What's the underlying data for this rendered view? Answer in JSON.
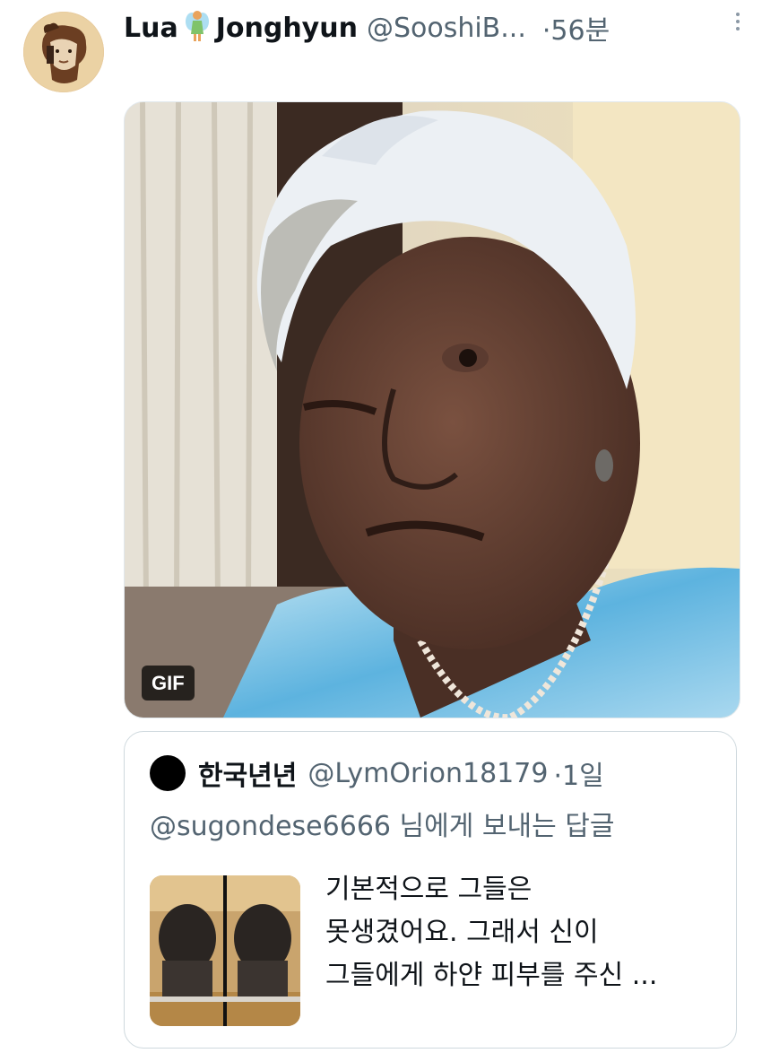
{
  "tweet": {
    "display_name_part1": "Lua",
    "emoji": "🧚",
    "display_name_part2": "Jonghyun",
    "handle": "@SooshiB...",
    "separator": "·",
    "time": "56분",
    "more_icon": "more-vertical-icon",
    "media": {
      "badge": "GIF"
    }
  },
  "quoted_tweet": {
    "display_name": "한국년년",
    "handle": "@LymOrion18179",
    "separator": "·",
    "time": "1일",
    "reply_mention": "@sugondese6666",
    "reply_suffix": "님에게 보내는 답글",
    "text_lines": [
      "기본적으로 그들은",
      "못생겼어요. 그래서 신이",
      "그들에게 하얀 피부를 주신 ..."
    ]
  }
}
